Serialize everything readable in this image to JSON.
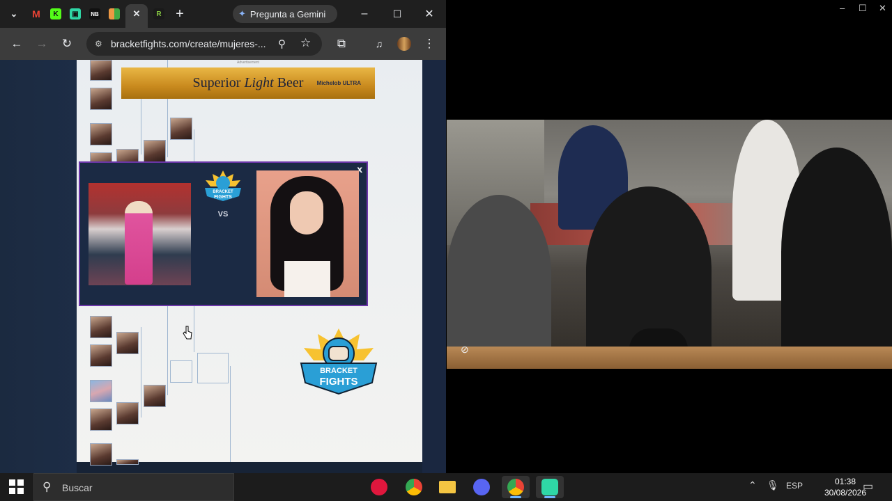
{
  "browser": {
    "tabs": [
      {
        "icon": "gmail-icon"
      },
      {
        "icon": "kick-icon"
      },
      {
        "icon": "tab-app-icon"
      },
      {
        "icon": "nba-icon",
        "text": "NB"
      },
      {
        "icon": "grid-app-icon"
      },
      {
        "icon": "close-icon",
        "text": "✕"
      },
      {
        "icon": "rumble-icon",
        "text": "R"
      }
    ],
    "new_tab": "+",
    "gemini_label": "Pregunta a Gemini",
    "window_controls": {
      "minimize": "–",
      "maximize": "☐",
      "close": "✕"
    },
    "url": "bracketfights.com/create/mujeres-..."
  },
  "page": {
    "ad_label": "Advertisement",
    "ad_text_1": "Superior",
    "ad_text_2": "Light",
    "ad_text_3": "Beer",
    "ad_brand": "Michelob ULTRA",
    "matchup": {
      "close": "x",
      "vs": "VS",
      "logo_text_1": "BRACKET",
      "logo_text_2": "FIGHTS"
    },
    "big_logo_1": "BRACKET",
    "big_logo_2": "FIGHTS"
  },
  "taskbar": {
    "search_placeholder": "Buscar",
    "language": "ESP",
    "time": "01:38",
    "date": "30/08/2026"
  },
  "colors": {
    "accent": "#6b36a8",
    "page_bg": "#172336",
    "logo_blue": "#2a9fd6",
    "logo_yellow": "#f7c230"
  }
}
